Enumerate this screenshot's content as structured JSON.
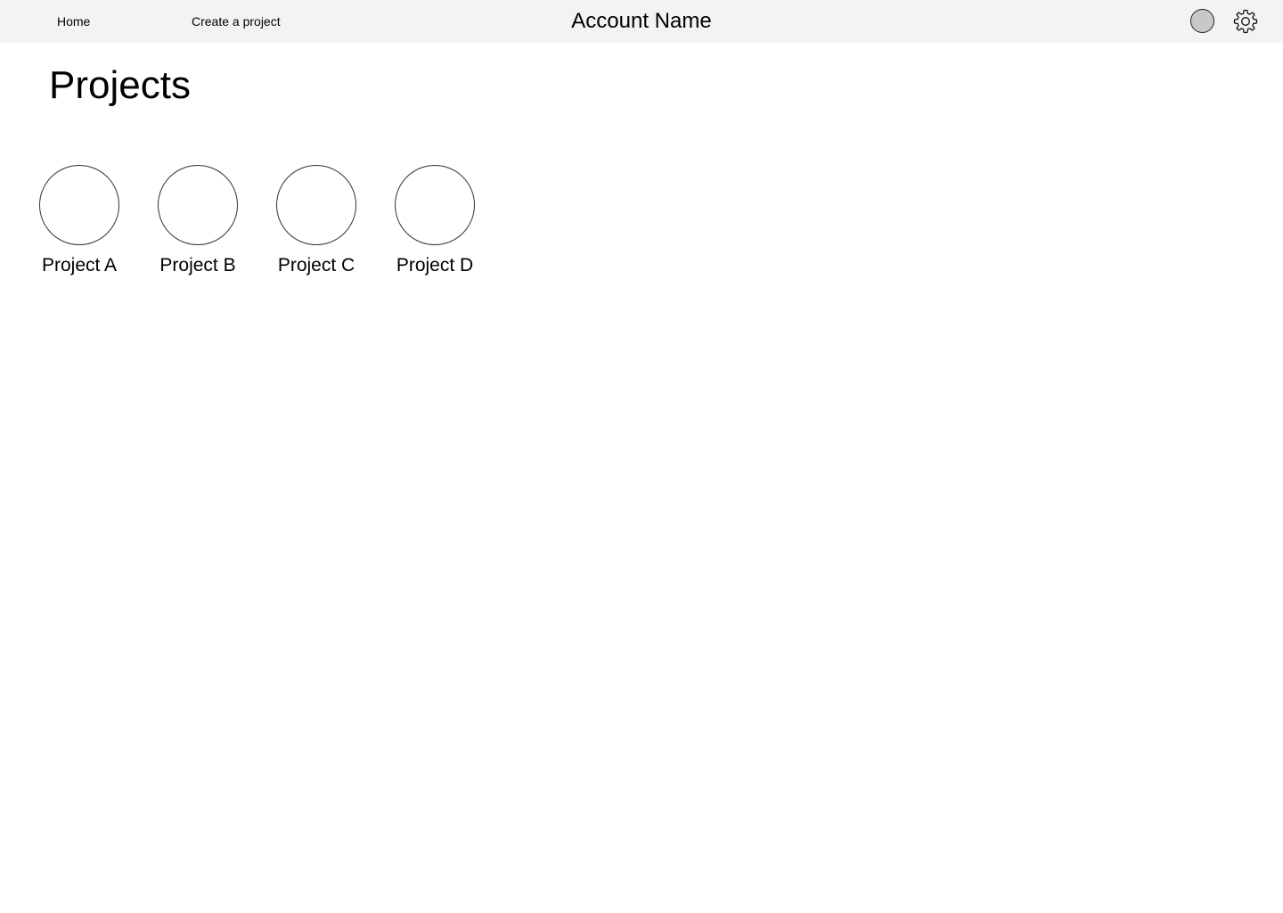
{
  "nav": {
    "home_label": "Home",
    "create_label": "Create a project",
    "account_name": "Account Name",
    "avatar_icon": "user-avatar-icon",
    "settings_icon": "gear-icon"
  },
  "main": {
    "title": "Projects",
    "projects": [
      {
        "label": "Project A",
        "icon": "project-thumbnail"
      },
      {
        "label": "Project B",
        "icon": "project-thumbnail"
      },
      {
        "label": "Project C",
        "icon": "project-thumbnail"
      },
      {
        "label": "Project D",
        "icon": "project-thumbnail"
      }
    ]
  },
  "colors": {
    "topbar_bg": "#f3f3f3",
    "avatar_fill": "#c8c8c8",
    "text": "#000000"
  }
}
